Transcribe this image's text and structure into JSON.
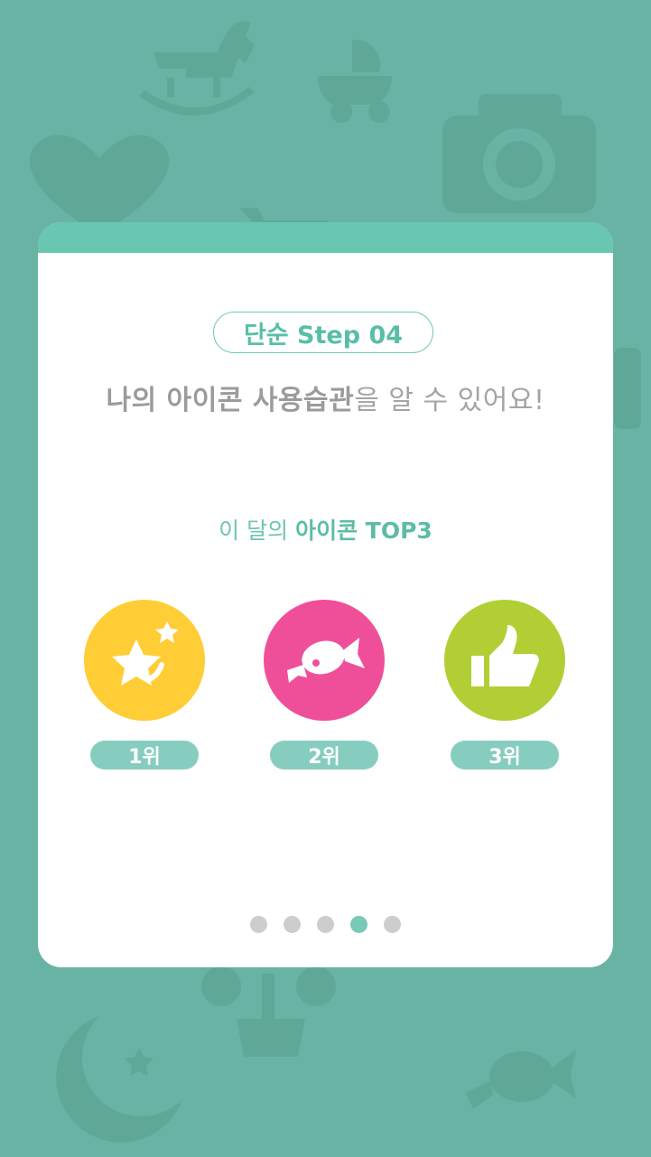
{
  "step": {
    "label": "단순 Step 04"
  },
  "headline": {
    "bold_part": "나의 아이콘 사용습관",
    "light_part": "을 알 수 있어요!"
  },
  "top3": {
    "prefix": "이 달의 ",
    "strong": "아이콘",
    "suffix": " TOP3",
    "items": [
      {
        "rank_label": "1위",
        "icon": "stars-icon",
        "color": "#ffcd36"
      },
      {
        "rank_label": "2위",
        "icon": "candy-icon",
        "color": "#ef4f99"
      },
      {
        "rank_label": "3위",
        "icon": "thumbs-up-icon",
        "color": "#b1cf35"
      }
    ]
  },
  "pagination": {
    "total": 5,
    "active_index": 3
  },
  "colors": {
    "background": "#68b3a4",
    "accent": "#68c6b1",
    "badge": "#86cdbf",
    "dot_inactive": "#cdcdcd"
  },
  "background_icons": [
    "rocking-horse-icon",
    "stroller-icon",
    "camera-icon",
    "heart-icon",
    "cart-icon",
    "flower-pot-icon",
    "moon-icon",
    "candy-icon"
  ]
}
